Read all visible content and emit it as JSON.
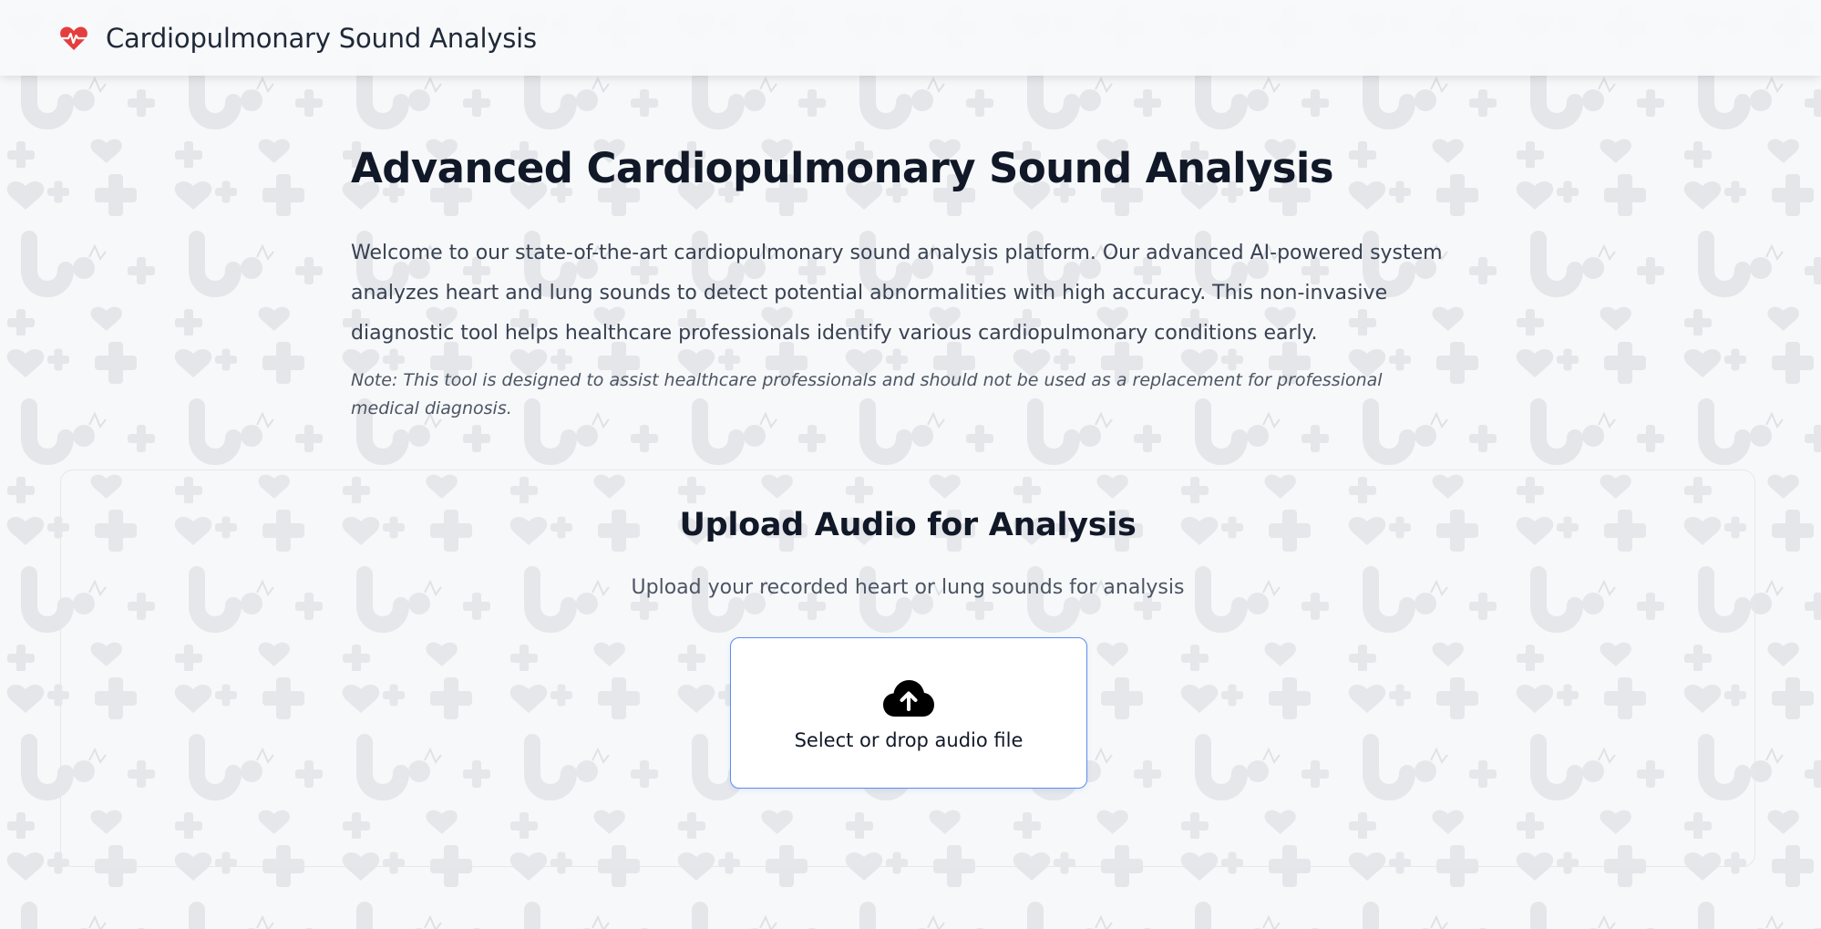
{
  "app": {
    "title": "Cardiopulmonary Sound Analysis",
    "brand_icon": "heart-pulse-icon",
    "brand_color": "#e53e3e"
  },
  "hero": {
    "title": "Advanced Cardiopulmonary Sound Analysis",
    "description": "Welcome to our state-of-the-art cardiopulmonary sound analysis platform. Our advanced AI-powered system analyzes heart and lung sounds to detect potential abnormalities with high accuracy. This non-invasive diagnostic tool helps healthcare professionals identify various cardiopulmonary conditions early.",
    "note": "Note: This tool is designed to assist healthcare professionals and should not be used as a replacement for professional medical diagnosis."
  },
  "upload": {
    "title": "Upload Audio for Analysis",
    "subtitle": "Upload your recorded heart or lung sounds for analysis",
    "dropzone_label": "Select or drop audio file",
    "dropzone_icon": "cloud-upload-icon",
    "accent_color": "#5b8def"
  },
  "background": {
    "pattern_icons": [
      "heart-icon",
      "plus-icon",
      "stethoscope-icon"
    ],
    "pattern_color": "#d9dde3"
  }
}
